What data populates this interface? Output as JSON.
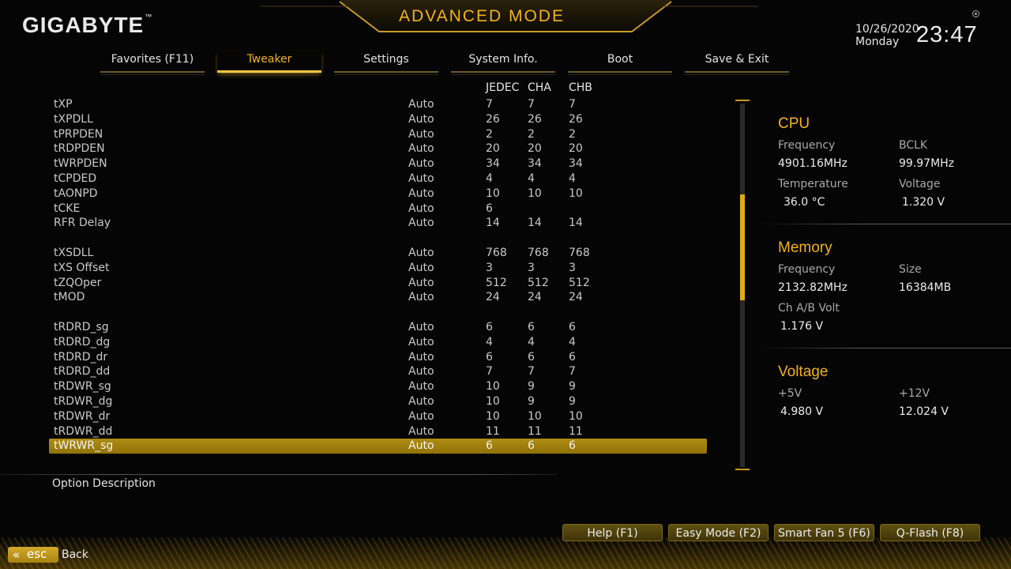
{
  "header": {
    "logo": "GIGABYTE",
    "logo_tm": "™",
    "mode_title": "ADVANCED MODE",
    "date": "10/26/2020",
    "weekday": "Monday",
    "time": "23:47"
  },
  "tabs": [
    {
      "label": "Favorites (F11)",
      "active": false
    },
    {
      "label": "Tweaker",
      "active": true
    },
    {
      "label": "Settings",
      "active": false
    },
    {
      "label": "System Info.",
      "active": false
    },
    {
      "label": "Boot",
      "active": false
    },
    {
      "label": "Save & Exit",
      "active": false
    }
  ],
  "columns": {
    "jedec": "JEDEC",
    "cha": "CHA",
    "chb": "CHB"
  },
  "rows": [
    {
      "name": "tXP",
      "mode": "Auto",
      "jedec": "7",
      "cha": "7",
      "chb": "7"
    },
    {
      "name": "tXPDLL",
      "mode": "Auto",
      "jedec": "26",
      "cha": "26",
      "chb": "26"
    },
    {
      "name": "tPRPDEN",
      "mode": "Auto",
      "jedec": "2",
      "cha": "2",
      "chb": "2"
    },
    {
      "name": "tRDPDEN",
      "mode": "Auto",
      "jedec": "20",
      "cha": "20",
      "chb": "20"
    },
    {
      "name": "tWRPDEN",
      "mode": "Auto",
      "jedec": "34",
      "cha": "34",
      "chb": "34"
    },
    {
      "name": "tCPDED",
      "mode": "Auto",
      "jedec": "4",
      "cha": "4",
      "chb": "4"
    },
    {
      "name": "tAONPD",
      "mode": "Auto",
      "jedec": "10",
      "cha": "10",
      "chb": "10"
    },
    {
      "name": "tCKE",
      "mode": "Auto",
      "jedec": "6",
      "cha": "",
      "chb": ""
    },
    {
      "name": "RFR Delay",
      "mode": "Auto",
      "jedec": "14",
      "cha": "14",
      "chb": "14"
    },
    {
      "spacer": true
    },
    {
      "name": "tXSDLL",
      "mode": "Auto",
      "jedec": "768",
      "cha": "768",
      "chb": "768"
    },
    {
      "name": "tXS Offset",
      "mode": "Auto",
      "jedec": "3",
      "cha": "3",
      "chb": "3"
    },
    {
      "name": "tZQOper",
      "mode": "Auto",
      "jedec": "512",
      "cha": "512",
      "chb": "512"
    },
    {
      "name": "tMOD",
      "mode": "Auto",
      "jedec": "24",
      "cha": "24",
      "chb": "24"
    },
    {
      "spacer": true
    },
    {
      "name": "tRDRD_sg",
      "mode": "Auto",
      "jedec": "6",
      "cha": "6",
      "chb": "6"
    },
    {
      "name": "tRDRD_dg",
      "mode": "Auto",
      "jedec": "4",
      "cha": "4",
      "chb": "4"
    },
    {
      "name": "tRDRD_dr",
      "mode": "Auto",
      "jedec": "6",
      "cha": "6",
      "chb": "6"
    },
    {
      "name": "tRDRD_dd",
      "mode": "Auto",
      "jedec": "7",
      "cha": "7",
      "chb": "7"
    },
    {
      "name": "tRDWR_sg",
      "mode": "Auto",
      "jedec": "10",
      "cha": "9",
      "chb": "9"
    },
    {
      "name": "tRDWR_dg",
      "mode": "Auto",
      "jedec": "10",
      "cha": "9",
      "chb": "9"
    },
    {
      "name": "tRDWR_dr",
      "mode": "Auto",
      "jedec": "10",
      "cha": "10",
      "chb": "10"
    },
    {
      "name": "tRDWR_dd",
      "mode": "Auto",
      "jedec": "11",
      "cha": "11",
      "chb": "11"
    },
    {
      "name": "tWRWR_sg",
      "mode": "Auto",
      "jedec": "6",
      "cha": "6",
      "chb": "6",
      "selected": true
    }
  ],
  "cpu": {
    "title": "CPU",
    "frequency_label": "Frequency",
    "frequency": "4901.16MHz",
    "bclk_label": "BCLK",
    "bclk": "99.97MHz",
    "temperature_label": "Temperature",
    "temperature": "36.0 °C",
    "voltage_label": "Voltage",
    "voltage": "1.320 V"
  },
  "memory": {
    "title": "Memory",
    "frequency_label": "Frequency",
    "frequency": "2132.82MHz",
    "size_label": "Size",
    "size": "16384MB",
    "volt_label": "Ch A/B Volt",
    "volt": "1.176 V"
  },
  "voltage": {
    "title": "Voltage",
    "v5_label": "+5V",
    "v5": "4.980 V",
    "v12_label": "+12V",
    "v12": "12.024 V"
  },
  "bottom": {
    "description_label": "Option Description",
    "help": "Help (F1)",
    "easy_mode": "Easy Mode (F2)",
    "smart_fan": "Smart Fan 5 (F6)",
    "qflash": "Q-Flash (F8)",
    "esc": "esc",
    "back": "Back"
  },
  "colors": {
    "accent": "#f2b21b",
    "selected_row": "#a3820f",
    "background": "#050505"
  }
}
